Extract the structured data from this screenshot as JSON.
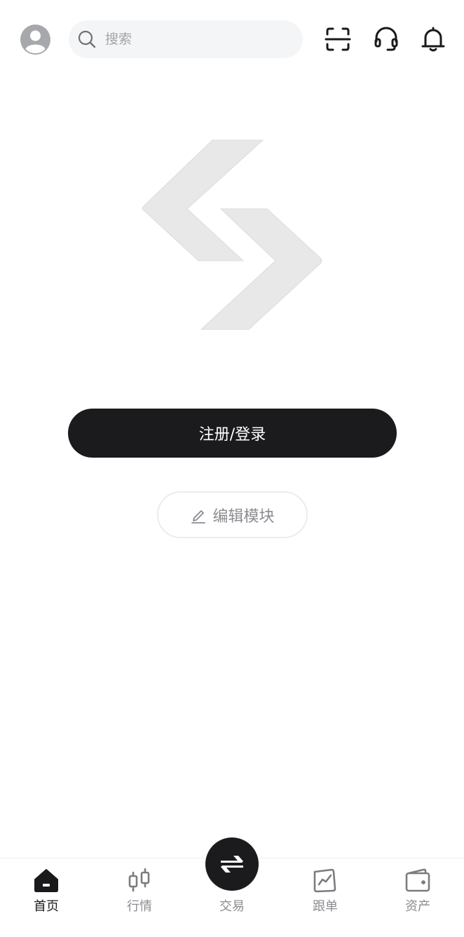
{
  "header": {
    "search": {
      "placeholder": "搜索"
    }
  },
  "main": {
    "login_label": "注册/登录",
    "edit_label": "编辑模块"
  },
  "bottom_nav": {
    "items": [
      {
        "label": "首页",
        "icon": "home-icon",
        "active": true
      },
      {
        "label": "行情",
        "icon": "candlestick-icon",
        "active": false
      },
      {
        "label": "交易",
        "icon": "swap-icon",
        "active": false
      },
      {
        "label": "跟单",
        "icon": "chart-card-icon",
        "active": false
      },
      {
        "label": "资产",
        "icon": "wallet-icon",
        "active": false
      }
    ]
  },
  "colors": {
    "primary": "#1b1b1d",
    "muted": "#8a8c90",
    "search_bg": "#f4f5f6",
    "logo_gray": "#e8e8e8"
  }
}
